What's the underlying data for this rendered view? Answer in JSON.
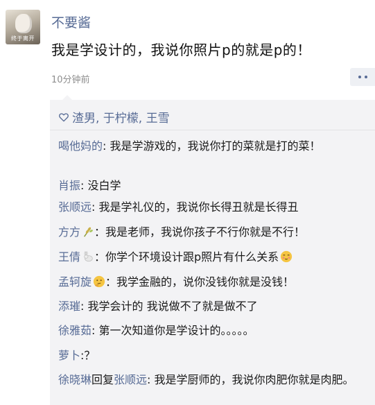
{
  "post": {
    "author": "不要酱",
    "avatar_caption": "终于离开",
    "content": "我是学设计的，我说你照片p的就是p的！",
    "time": "10分钟前"
  },
  "likes": {
    "names": "渣男, 于柠檬, 王雪"
  },
  "comments": [
    {
      "name": "喝他妈的",
      "text": ": 我是学游戏的，我说你打的菜就是打的菜！"
    },
    {
      "name": "肖振",
      "text": ": 没白学"
    },
    {
      "name": "张顺远",
      "text": ": 我是学礼仪的，我说你长得丑就是长得丑"
    },
    {
      "name": "方方",
      "text": "：我是老师，我说你孩子不行你就是不行！"
    },
    {
      "name": "王倩",
      "text": "：你学个环境设计跟p照片有什么关系"
    },
    {
      "name": "孟轲旋",
      "text": "：我学金融的，说你没钱你就是没钱！"
    },
    {
      "name": "添璀",
      "text": ": 我学会计的 我说做不了就是做不了"
    },
    {
      "name": "徐雅茹",
      "text": ": 第一次知道你是学设计的。。。。。"
    },
    {
      "name": "萝卜",
      "text": ":？"
    },
    {
      "name": "徐晓琳",
      "reply_word": "回复",
      "reply_to": "张顺远",
      "text": ": 我是学厨师的，我说你肉肥你就是肉肥。"
    }
  ],
  "icons": {
    "like": "heart-outline-icon",
    "more": "more-dots-icon",
    "name_emoji_1": "wheat-emoji-icon",
    "name_emoji_2": "rabbit-emoji-icon",
    "name_emoji_3": "thinking-face-emoji-icon",
    "text_emoji_1": "blushing-face-emoji-icon"
  },
  "colors": {
    "name_link": "#576b95",
    "comment_bg": "#f3f3f5",
    "time": "#8e8e8e"
  }
}
